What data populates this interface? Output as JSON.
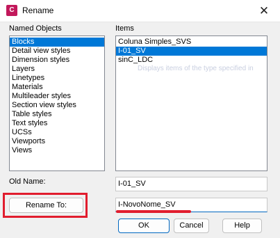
{
  "window": {
    "app_icon_letter": "C",
    "title": "Rename",
    "close_glyph": "✕"
  },
  "named_objects": {
    "label": "Named Objects",
    "items": [
      "Blocks",
      "Detail view styles",
      "Dimension styles",
      "Layers",
      "Linetypes",
      "Materials",
      "Multileader styles",
      "Section view styles",
      "Table styles",
      "Text styles",
      "UCSs",
      "Viewports",
      "Views"
    ],
    "selected_index": 0
  },
  "items": {
    "label": "Items",
    "list": [
      "Coluna Simples_SVS",
      "I-01_SV",
      "sinC_LDC"
    ],
    "selected_index": 1,
    "tooltip_ghost": "Displays items of the type specified in"
  },
  "old_name": {
    "label": "Old Name:",
    "value": "I-01_SV"
  },
  "rename_to": {
    "button_label": "Rename To:",
    "value": "I-NovoNome_SV"
  },
  "buttons": {
    "ok": "OK",
    "cancel": "Cancel",
    "help": "Help"
  },
  "colors": {
    "selection": "#0078d7",
    "annotation_red": "#e11d2e",
    "app_icon": "#c2185b"
  }
}
